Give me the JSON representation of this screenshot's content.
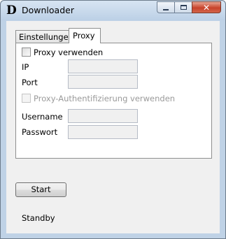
{
  "window": {
    "title": "Downloader",
    "icon_letter": "D",
    "icon_name": "downloader-app-icon",
    "caption_buttons": {
      "minimize_icon": "minimize-icon",
      "maximize_icon": "maximize-icon",
      "close_icon": "close-icon",
      "close_glyph": "✕"
    }
  },
  "tabs": [
    {
      "label": "Einstellungen",
      "selected": false
    },
    {
      "label": "Proxy",
      "selected": true
    }
  ],
  "proxy": {
    "use_proxy_label": "Proxy verwenden",
    "use_proxy_checked": false,
    "ip_label": "IP",
    "ip_value": "",
    "port_label": "Port",
    "port_value": "",
    "auth_label": "Proxy-Authentifizierung verwenden",
    "auth_checked": false,
    "auth_enabled": false,
    "username_label": "Username",
    "username_value": "",
    "password_label": "Passwort",
    "password_value": ""
  },
  "actions": {
    "start_label": "Start"
  },
  "status": {
    "text": "Standby"
  }
}
